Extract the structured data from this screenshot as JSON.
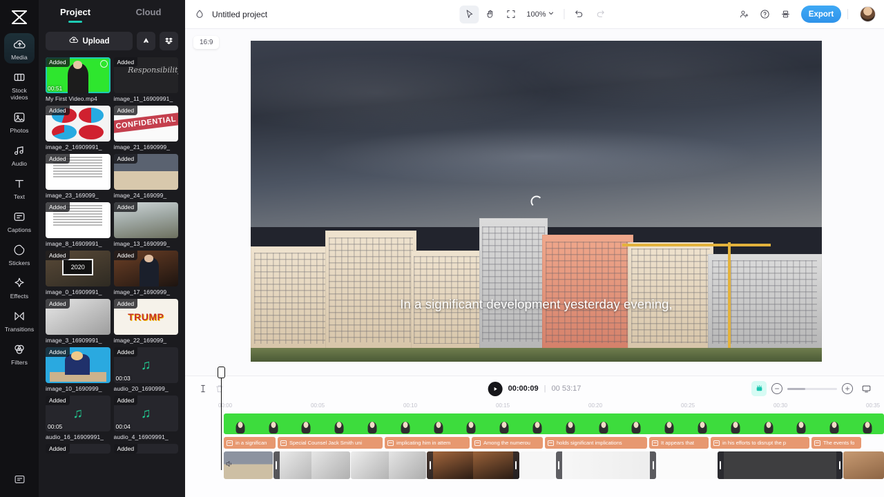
{
  "rail": {
    "logo_icon": "capcut-logo-icon",
    "items": [
      {
        "label": "Media",
        "icon": "cloud-upload-icon",
        "active": true
      },
      {
        "label": "Stock\nvideos",
        "icon": "film-icon",
        "active": false
      },
      {
        "label": "Photos",
        "icon": "image-icon",
        "active": false
      },
      {
        "label": "Audio",
        "icon": "music-note-icon",
        "active": false
      },
      {
        "label": "Text",
        "icon": "text-t-icon",
        "active": false
      },
      {
        "label": "Captions",
        "icon": "captions-icon",
        "active": false
      },
      {
        "label": "Stickers",
        "icon": "sticker-icon",
        "active": false
      },
      {
        "label": "Effects",
        "icon": "sparkle-icon",
        "active": false
      },
      {
        "label": "Transitions",
        "icon": "transitions-icon",
        "active": false
      },
      {
        "label": "Filters",
        "icon": "filters-icon",
        "active": false
      }
    ],
    "bottom_icon": "feedback-icon"
  },
  "panel": {
    "tabs": [
      {
        "label": "Project",
        "active": true
      },
      {
        "label": "Cloud",
        "active": false
      }
    ],
    "upload_label": "Upload",
    "upload_icon": "cloud-upload-icon",
    "drive_icon": "google-drive-icon",
    "dropbox_icon": "dropbox-icon",
    "added_badge": "Added",
    "media": [
      {
        "name": "My First Video.mp4",
        "duration": "00:51",
        "kind": "video-green",
        "selected": true
      },
      {
        "name": "image_11_16909991_",
        "kind": "chalk",
        "art_text": "Responsibility"
      },
      {
        "name": "image_2_16909991_",
        "kind": "pies"
      },
      {
        "name": "image_21_1690999_",
        "kind": "confidential",
        "art_text": "CONFIDENTIAL"
      },
      {
        "name": "image_23_169099_",
        "kind": "document"
      },
      {
        "name": "image_24_169099_",
        "kind": "storm"
      },
      {
        "name": "image_8_16909991_",
        "kind": "document"
      },
      {
        "name": "image_13_1690999_",
        "kind": "street"
      },
      {
        "name": "image_0_16909991_",
        "kind": "tablet",
        "art_text": "2020"
      },
      {
        "name": "image_17_1690999_",
        "kind": "suit"
      },
      {
        "name": "image_3_16909991_",
        "kind": "news"
      },
      {
        "name": "image_22_169099_",
        "kind": "trump",
        "art_text": "TRUMP"
      },
      {
        "name": "image_10_1690999_",
        "kind": "cartoon"
      },
      {
        "name": "audio_20_1690999_",
        "kind": "audio",
        "duration": "00:03"
      },
      {
        "name": "audio_16_16909991_",
        "kind": "audio",
        "duration": "00:05"
      },
      {
        "name": "audio_4_16909991_",
        "kind": "audio",
        "duration": "00:04"
      },
      {
        "name": "",
        "kind": "partial"
      },
      {
        "name": "",
        "kind": "partial"
      }
    ]
  },
  "topbar": {
    "logo_icon": "capcut-mark-icon",
    "project_title": "Untitled project",
    "tools": [
      {
        "icon": "select-arrow-icon",
        "active": true
      },
      {
        "icon": "hand-pan-icon",
        "active": false
      },
      {
        "icon": "crop-frame-icon",
        "active": false
      }
    ],
    "zoom_value": "100%",
    "zoom_caret_icon": "chevron-down-icon",
    "undo_icon": "undo-icon",
    "redo_icon": "redo-icon",
    "collaborate_icon": "add-person-icon",
    "help_icon": "question-circle-icon",
    "layout_icon": "layout-icon",
    "export_label": "Export",
    "avatar_icon": "user-avatar"
  },
  "preview": {
    "ratio_badge": "16:9",
    "loading_icon": "loading-spinner-icon",
    "subtitle": "In a significant development yesterday evening,"
  },
  "timeline": {
    "split_icon": "split-cursor-icon",
    "delete_icon": "trash-icon",
    "play_icon": "play-icon",
    "current_time": "00:00:09",
    "separator": "|",
    "total_time": "00 53:17",
    "magic_icon": "auto-caption-icon",
    "zoom_out_icon": "minus-circle-icon",
    "zoom_in_icon": "plus-circle-icon",
    "fit_icon": "fit-screen-icon",
    "speaker_icon": "speaker-icon",
    "ruler_ticks": [
      "00:00",
      "00:05",
      "00:10",
      "00:15",
      "00:20",
      "00:25",
      "00:30",
      "00:35"
    ],
    "caption_clips": [
      {
        "text": "in a significan",
        "width": 75
      },
      {
        "text": "Special Counsel Jack Smith uni",
        "width": 152
      },
      {
        "text": "implicating him in attem",
        "width": 123
      },
      {
        "text": "Among the numerou",
        "width": 103
      },
      {
        "text": "holds significant implications",
        "width": 148
      },
      {
        "text": "It appears that",
        "width": 86
      },
      {
        "text": "in his efforts to disrupt the p",
        "width": 143
      },
      {
        "text": "The events fo",
        "width": 72
      }
    ],
    "media_clips": [
      {
        "kind": "storm",
        "width": 72
      },
      {
        "kind": "news",
        "width": 113
      },
      {
        "kind": "news",
        "width": 112
      },
      {
        "kind": "suit",
        "width": 136
      },
      {
        "kind": "document",
        "width": 52
      },
      {
        "kind": "confidential",
        "width": 148
      },
      {
        "kind": "sketch",
        "width": 88
      },
      {
        "kind": "chalk",
        "width": 185
      },
      {
        "kind": "tablet",
        "width": 60
      }
    ]
  }
}
